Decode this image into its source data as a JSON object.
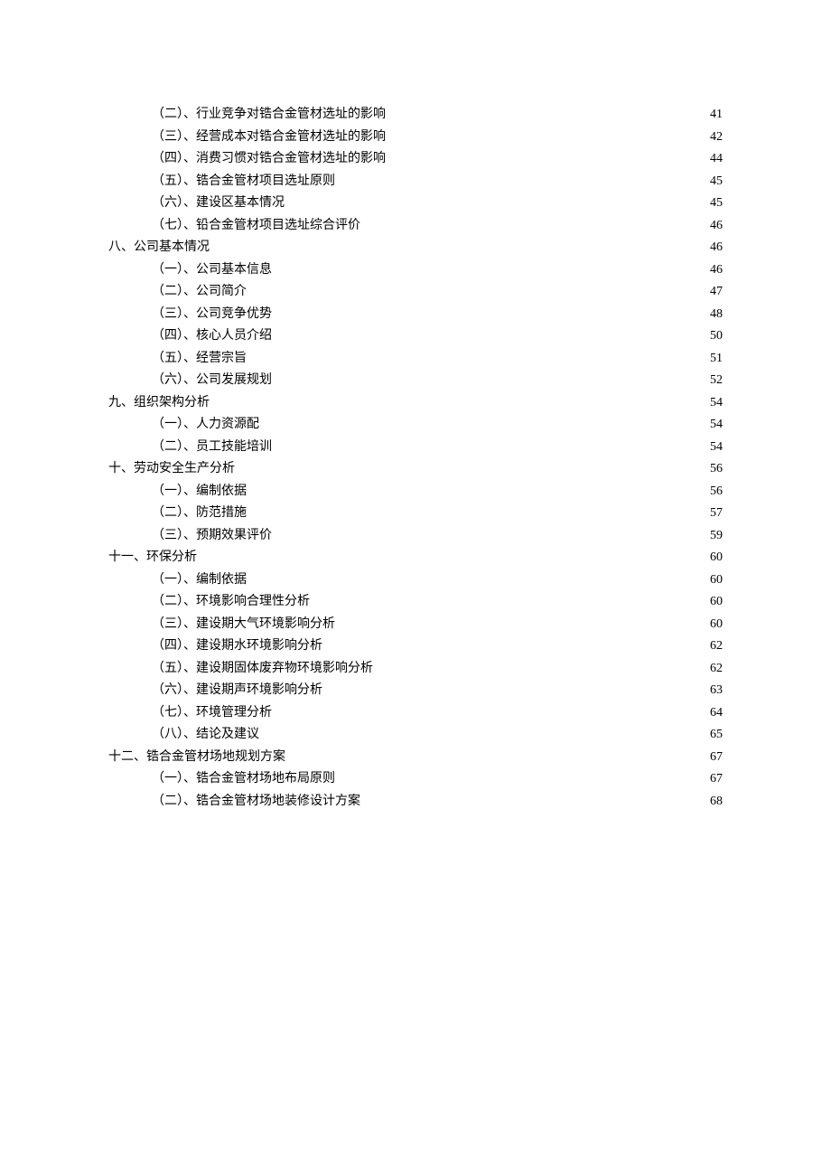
{
  "toc": [
    {
      "level": 2,
      "label": "（二）、行业竞争对锆合金管材选址的影响",
      "page": "41"
    },
    {
      "level": 2,
      "label": "（三）、经营成本对锆合金管材选址的影响",
      "page": "42"
    },
    {
      "level": 2,
      "label": "（四）、消费习惯对锆合金管材选址的影响",
      "page": "44"
    },
    {
      "level": 2,
      "label": "（五）、锆合金管材项目选址原则",
      "page": "45"
    },
    {
      "level": 2,
      "label": "（六）、建设区基本情况",
      "page": "45"
    },
    {
      "level": 2,
      "label": "（七）、铅合金管材项目选址综合评价",
      "page": "46"
    },
    {
      "level": 1,
      "label": "八、公司基本情况 ",
      "page": "46"
    },
    {
      "level": 2,
      "label": "（一）、公司基本信息",
      "page": "46"
    },
    {
      "level": 2,
      "label": "（二）、公司简介",
      "page": "47"
    },
    {
      "level": 2,
      "label": "（三）、公司竞争优势",
      "page": "48"
    },
    {
      "level": 2,
      "label": "（四）、核心人员介绍",
      "page": "50"
    },
    {
      "level": 2,
      "label": "（五）、经营宗旨",
      "page": "51"
    },
    {
      "level": 2,
      "label": "（六）、公司发展规划",
      "page": "52"
    },
    {
      "level": 1,
      "label": "九、组织架构分析 ",
      "page": "54"
    },
    {
      "level": 2,
      "label": "（一）、人力资源配",
      "page": "54"
    },
    {
      "level": 2,
      "label": "（二）、员工技能培训",
      "page": "54"
    },
    {
      "level": 1,
      "label": "十、劳动安全生产分析 ",
      "page": "56"
    },
    {
      "level": 2,
      "label": "（一）、编制依据",
      "page": "56"
    },
    {
      "level": 2,
      "label": "（二）、防范措施",
      "page": "57"
    },
    {
      "level": 2,
      "label": "（三）、预期效果评价",
      "page": "59"
    },
    {
      "level": 1,
      "label": "十一、环保分析 ",
      "page": "60"
    },
    {
      "level": 2,
      "label": "（一）、编制依据",
      "page": "60"
    },
    {
      "level": 2,
      "label": "（二）、环境影响合理性分析",
      "page": "60"
    },
    {
      "level": 2,
      "label": "（三）、建设期大气环境影响分析",
      "page": "60"
    },
    {
      "level": 2,
      "label": "（四）、建设期水环境影响分析",
      "page": "62"
    },
    {
      "level": 2,
      "label": "（五）、建设期固体废弃物环境影响分析",
      "page": "62"
    },
    {
      "level": 2,
      "label": "（六）、建设期声环境影响分析",
      "page": "63"
    },
    {
      "level": 2,
      "label": "（七）、环境管理分析",
      "page": "64"
    },
    {
      "level": 2,
      "label": "（八）、结论及建议",
      "page": "65"
    },
    {
      "level": 1,
      "label": "十二、锆合金管材场地规划方案 ",
      "page": "67"
    },
    {
      "level": 2,
      "label": "（一）、锆合金管材场地布局原则",
      "page": "67"
    },
    {
      "level": 2,
      "label": "（二）、锆合金管材场地装修设计方案",
      "page": "68"
    }
  ]
}
